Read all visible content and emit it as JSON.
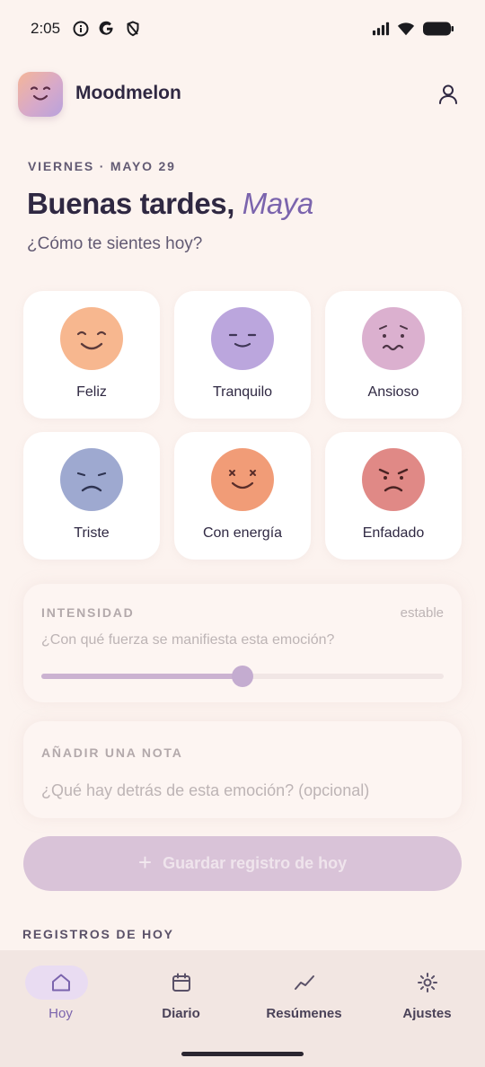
{
  "status_bar": {
    "time": "2:05",
    "left_icons": [
      "info-icon",
      "google-icon",
      "shield-icon"
    ],
    "right_icons": [
      "signal-icon",
      "wifi-icon",
      "battery-icon"
    ]
  },
  "header": {
    "app_name": "Moodmelon",
    "logo_icon": "smile-logo-icon",
    "profile_icon": "user-icon"
  },
  "greeting": {
    "date": "VIERNES · MAYO 29",
    "salutation": "Buenas tardes, ",
    "name": "Maya",
    "question": "¿Cómo te sientes hoy?"
  },
  "moods": [
    {
      "label": "Feliz",
      "color": "#f7b78f",
      "face": "happy"
    },
    {
      "label": "Tranquilo",
      "color": "#bba6dd",
      "face": "calm"
    },
    {
      "label": "Ansioso",
      "color": "#dbb0cf",
      "face": "anxious"
    },
    {
      "label": "Triste",
      "color": "#9ea9d0",
      "face": "sad"
    },
    {
      "label": "Con energía",
      "color": "#f19c77",
      "face": "energetic"
    },
    {
      "label": "Enfadado",
      "color": "#e08986",
      "face": "angry"
    }
  ],
  "intensity": {
    "label": "INTENSIDAD",
    "state": "estable",
    "question": "¿Con qué fuerza se manifiesta esta emoción?",
    "value_fraction": 0.5
  },
  "note": {
    "label": "AÑADIR UNA NOTA",
    "placeholder": "¿Qué hay detrás de esta emoción? (opcional)"
  },
  "save_button": {
    "icon": "plus-icon",
    "label": "Guardar registro de hoy"
  },
  "records": {
    "title": "REGISTROS DE HOY"
  },
  "nav": {
    "items": [
      {
        "label": "Hoy",
        "icon": "home-icon",
        "active": true
      },
      {
        "label": "Diario",
        "icon": "calendar-icon",
        "active": false
      },
      {
        "label": "Resúmenes",
        "icon": "trend-icon",
        "active": false
      },
      {
        "label": "Ajustes",
        "icon": "settings-icon",
        "active": false
      }
    ]
  }
}
